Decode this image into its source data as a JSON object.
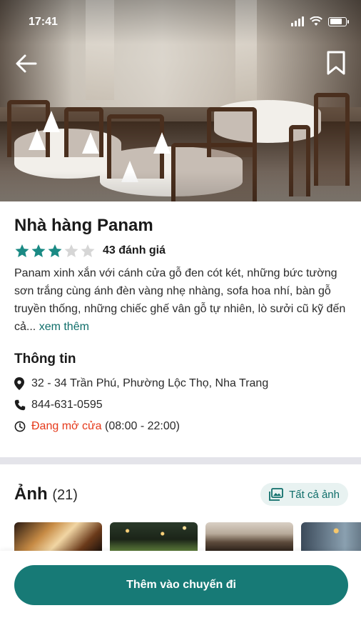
{
  "status_bar": {
    "time": "17:41"
  },
  "restaurant": {
    "name": "Nhà hàng Panam",
    "rating": 3,
    "rating_max": 5,
    "review_count": "43 đánh giá",
    "description": "Panam xinh xắn với cánh cửa gỗ đen cót két, những bức tường sơn trắng cùng ánh đèn vàng nhẹ nhàng, sofa hoa nhí, bàn gỗ truyền thống, những chiếc ghế vân gỗ tự nhiên, lò sưởi cũ kỹ đến cả...",
    "read_more": "xem thêm"
  },
  "info": {
    "title": "Thông tin",
    "address": "32 - 34 Trần Phú, Phường Lộc Thọ, Nha Trang",
    "phone": "844-631-0595",
    "open_status": "Đang mở cửa",
    "hours": "(08:00 - 22:00)"
  },
  "photos": {
    "title": "Ảnh",
    "count": "(21)",
    "all_label": "Tất cả ảnh"
  },
  "cta": {
    "label": "Thêm vào chuyến đi"
  },
  "icons": {
    "back": "arrow-left-icon",
    "bookmark": "bookmark-icon",
    "location": "map-pin-icon",
    "phone": "phone-icon",
    "clock": "clock-icon",
    "gallery": "image-gallery-icon"
  },
  "colors": {
    "accent": "#177a76",
    "link": "#0f6e6a",
    "star_filled": "#1a8a84",
    "star_empty": "#d6d6d6",
    "open_status": "#e5391a"
  }
}
